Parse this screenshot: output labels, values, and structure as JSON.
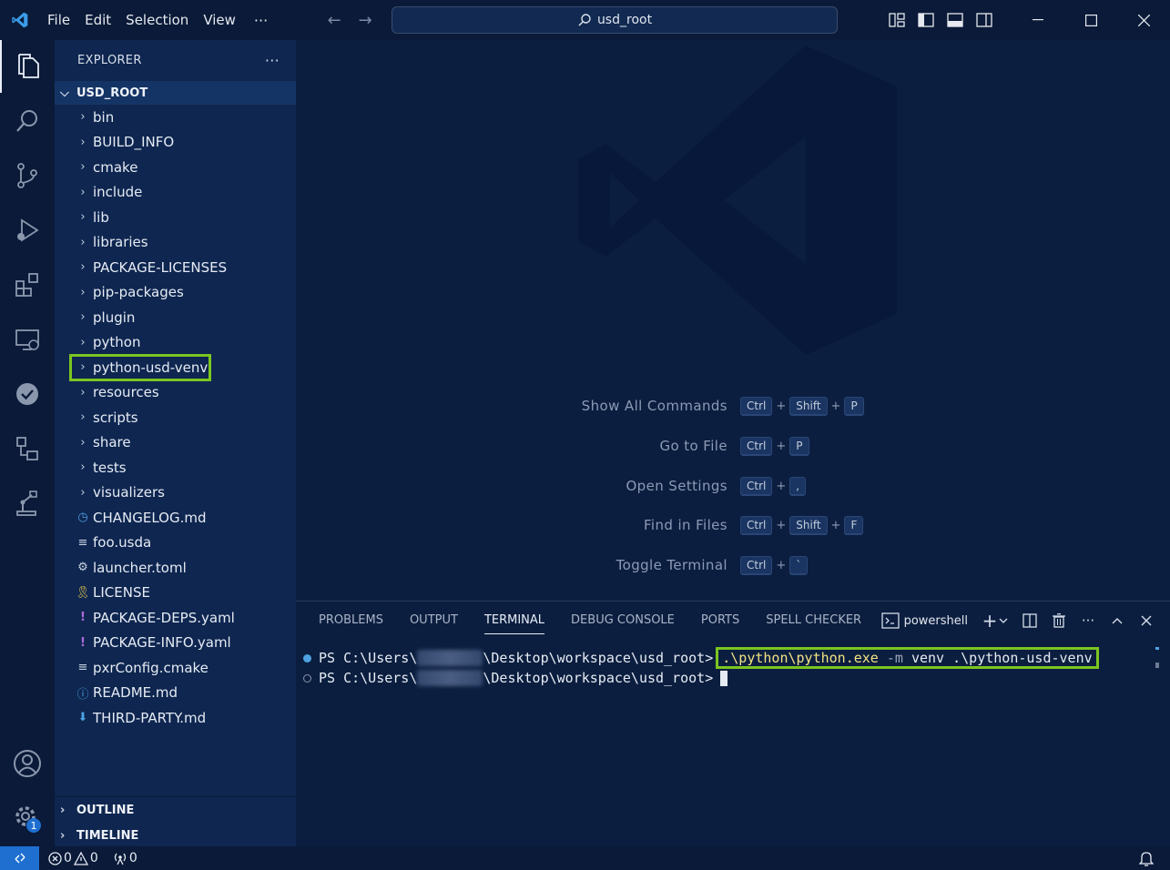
{
  "titlebar": {
    "menus": [
      "File",
      "Edit",
      "Selection",
      "View"
    ],
    "more": "···",
    "search": "usd_root"
  },
  "explorer": {
    "title": "EXPLORER",
    "more": "···",
    "root": "USD_ROOT",
    "folders": [
      "bin",
      "BUILD_INFO",
      "cmake",
      "include",
      "lib",
      "libraries",
      "PACKAGE-LICENSES",
      "pip-packages",
      "plugin",
      "python",
      "python-usd-venv",
      "resources",
      "scripts",
      "share",
      "tests",
      "visualizers"
    ],
    "files": [
      {
        "name": "CHANGELOG.md",
        "icon": "clock-icon"
      },
      {
        "name": "foo.usda",
        "icon": "lines-icon"
      },
      {
        "name": "launcher.toml",
        "icon": "gear-icon"
      },
      {
        "name": "LICENSE",
        "icon": "ribbon-icon"
      },
      {
        "name": "PACKAGE-DEPS.yaml",
        "icon": "exclamation-icon"
      },
      {
        "name": "PACKAGE-INFO.yaml",
        "icon": "exclamation-icon"
      },
      {
        "name": "pxrConfig.cmake",
        "icon": "lines-icon"
      },
      {
        "name": "README.md",
        "icon": "info-icon"
      },
      {
        "name": "THIRD-PARTY.md",
        "icon": "download-icon"
      }
    ],
    "outline": "OUTLINE",
    "timeline": "TIMELINE"
  },
  "welcome": {
    "shortcuts": [
      {
        "label": "Show All Commands",
        "keys": [
          "Ctrl",
          "Shift",
          "P"
        ]
      },
      {
        "label": "Go to File",
        "keys": [
          "Ctrl",
          "P"
        ]
      },
      {
        "label": "Open Settings",
        "keys": [
          "Ctrl",
          ","
        ]
      },
      {
        "label": "Find in Files",
        "keys": [
          "Ctrl",
          "Shift",
          "F"
        ]
      },
      {
        "label": "Toggle Terminal",
        "keys": [
          "Ctrl",
          "`"
        ]
      }
    ]
  },
  "panel": {
    "tabs": [
      "PROBLEMS",
      "OUTPUT",
      "TERMINAL",
      "DEBUG CONSOLE",
      "PORTS",
      "SPELL CHECKER"
    ],
    "active_tab": "TERMINAL",
    "profile": "powershell",
    "terminal": {
      "prompt_start": "PS C:\\Users\\",
      "prompt_end": "\\Desktop\\workspace\\usd_root>",
      "cmd_exe": ".\\python\\python.exe",
      "cmd_flag": "-m",
      "cmd_args": "venv .\\python-usd-venv"
    }
  },
  "statusbar": {
    "errors": "0",
    "warnings": "0",
    "ports": "0",
    "settings_badge": "1"
  },
  "colors": {
    "highlight": "#7cc520",
    "accent": "#1e6fd0"
  }
}
